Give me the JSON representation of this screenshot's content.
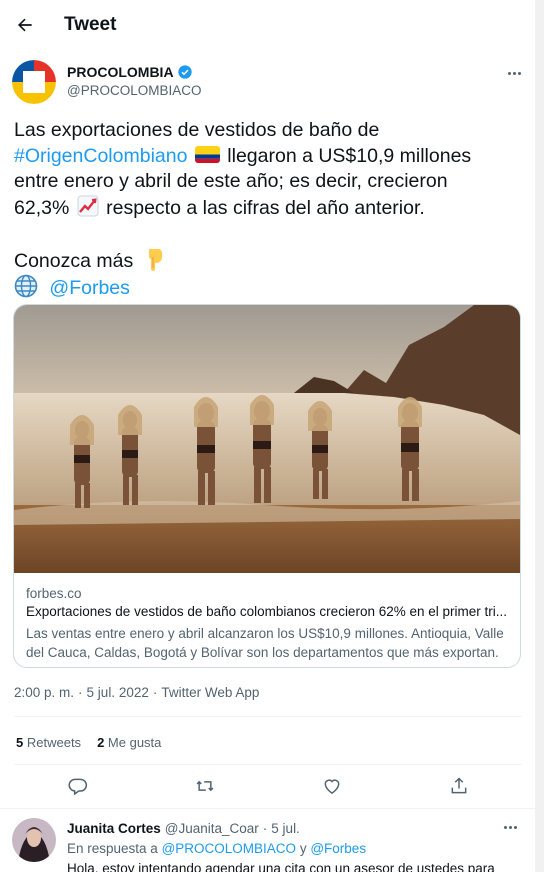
{
  "header": {
    "title": "Tweet"
  },
  "author": {
    "name": "PROCOLOMBIA",
    "handle": "@PROCOLOMBIACO"
  },
  "tweet": {
    "line1": "Las exportaciones de vestidos de baño de",
    "hashtag": "#OrigenColombiano",
    "line2_rest": "llegaron a US$10,9 millones",
    "line3": "entre enero y abril de este año; es decir, crecieron",
    "line4_pre": "62,3%",
    "line4_post": "respecto a las cifras del año anterior.",
    "line5": "Conozca más",
    "mention": "@Forbes"
  },
  "card": {
    "domain": "forbes.co",
    "title": "Exportaciones de vestidos de baño colombianos crecieron 62% en el primer tri...",
    "desc_line1": "Las ventas entre enero y abril alcanzaron los US$10,9 millones. Antioquia, Valle",
    "desc_line2": "del Cauca, Caldas, Bogotá y Bolívar son los departamentos que más exportan."
  },
  "meta": {
    "time": "2:00 p. m.",
    "sep1": "·",
    "date": "5 jul. 2022",
    "sep2": "·",
    "source": "Twitter Web App"
  },
  "stats": {
    "retweets_count": "5",
    "retweets_label": "Retweets",
    "likes_count": "2",
    "likes_label": "Me gusta"
  },
  "reply": {
    "name": "Juanita Cortes",
    "handle": "@Juanita_Coar",
    "sep": "·",
    "date": "5 jul.",
    "to_prefix": "En respuesta a",
    "to_mention1": "@PROCOLOMBIACO",
    "to_and": "y",
    "to_mention2": "@Forbes",
    "text": "Hola, estoy intentando agendar una cita con un asesor de ustedes para"
  },
  "colors": {
    "accent": "#1d9bf0",
    "text": "#0f1419",
    "secondary": "#536471",
    "border": "#cfd9de"
  },
  "icons": [
    "back-arrow-icon",
    "verified-badge-icon",
    "more-icon",
    "colombia-flag-icon",
    "chart-increasing-icon",
    "pointing-down-icon",
    "globe-icon",
    "reply-icon",
    "retweet-icon",
    "like-icon",
    "share-icon"
  ]
}
